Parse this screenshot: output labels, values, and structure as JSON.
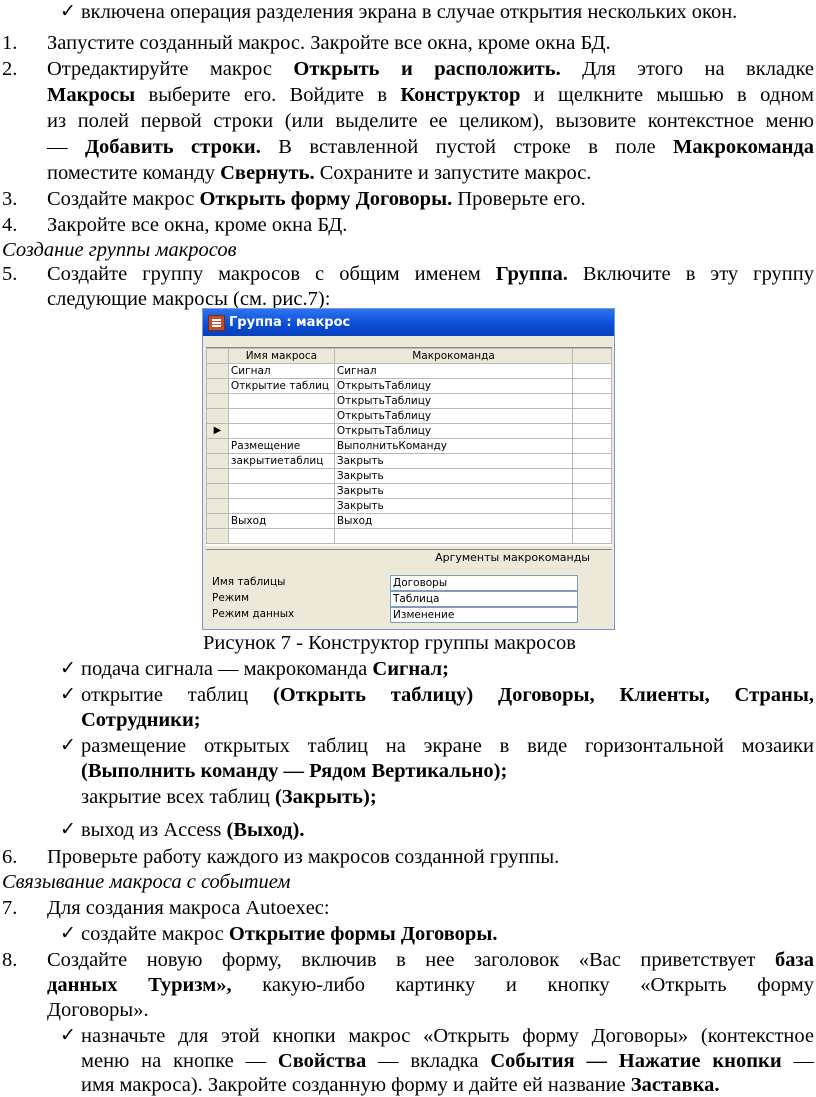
{
  "l1": "включена операция разделения экрана в случае открытия нескольких окон.",
  "s1": "Запустите созданный макрос. Закройте все окна, кроме окна БД.",
  "s2_a": "Отредактируйте макрос ",
  "s2_b": "Открыть и расположить.",
  "s2_c": " Для этого на вкладке",
  "s2_d": "Макросы",
  "s2_e": " выберите его. Войдите в ",
  "s2_f": "Конструктор",
  "s2_g": " и щелкните мышью в одном",
  "s2_h": "из полей первой строки (или выделите ее целиком), вызовите контекстное меню",
  "s2_i": "— ",
  "s2_j": "Добавить строки.",
  "s2_k": " В вставленной пустой строке в поле ",
  "s2_l": "Макрокоманда",
  "s2_m": "поместите команду ",
  "s2_n": "Свернуть.",
  "s2_o": " Сохраните и запустите макрос.",
  "s3_a": "Создайте макрос ",
  "s3_b": "Открыть форму Договоры.",
  "s3_c": " Проверьте его.",
  "s4": "Закройте все окна, кроме окна БД.",
  "h1": "Создание группы макросов",
  "s5_a": "Создайте группу макросов с общим именем ",
  "s5_b": "Группа.",
  "s5_c": " Включите в эту группу",
  "s5_d": "следующие макросы (см. рис.7):",
  "window": {
    "title": "Группа : макрос",
    "col1": "Имя макроса",
    "col2": "Макрокоманда",
    "rows": [
      [
        "Сигнал",
        "Сигнал"
      ],
      [
        "Открытие таблиц",
        "ОткрытьТаблицу"
      ],
      [
        "",
        "ОткрытьТаблицу"
      ],
      [
        "",
        "ОткрытьТаблицу"
      ],
      [
        "",
        "ОткрытьТаблицу"
      ],
      [
        "Размещение",
        "ВыполнитьКоманду"
      ],
      [
        "закрытиетаблиц",
        "Закрыть"
      ],
      [
        "",
        "Закрыть"
      ],
      [
        "",
        "Закрыть"
      ],
      [
        "",
        "Закрыть"
      ],
      [
        "Выход",
        "Выход"
      ],
      [
        "",
        ""
      ]
    ],
    "args_title": "Аргументы макрокоманды",
    "args": [
      [
        "Имя таблицы",
        "Договоры"
      ],
      [
        "Режим",
        "Таблица"
      ],
      [
        "Режим данных",
        "Изменение"
      ]
    ]
  },
  "caption": "Рисунок 7 - Конструктор группы макросов",
  "b1_a": "подача сигнала — макрокоманда ",
  "b1_b": "Сигнал;",
  "b2_a": "открытие таблиц ",
  "b2_b": "(Открыть таблицу) Договоры, Клиенты, Страны,",
  "b2_c": "Сотрудники;",
  "b3_a": "размещение открытых таблиц на экране в виде горизонтальной мозаики",
  "b3_b": "(Выполнить команду — Рядом Вертикально);",
  "b3_c_a": "закрытие всех таблиц ",
  "b3_c_b": "(Закрыть);",
  "b4_a": "выход из Access ",
  "b4_b": "(Выход).",
  "s6": "Проверьте работу каждого из макросов созданной группы.",
  "h2": "Связывание макроса с событием",
  "s7": "Для создания макроса Autoexec:",
  "b5_a": "создайте макрос ",
  "b5_b": "Открытие формы Договоры.",
  "s8_a": "Создайте новую форму, включив в нее заголовок «Вас приветствует ",
  "s8_b": "база",
  "s8_c": "данных Туризм»,",
  "s8_d": " какую-либо картинку и кнопку «Открыть форму",
  "s8_e": "Договоры».",
  "b6_a": "назначьте для этой кнопки макрос «Открыть форму Договоры» (контекстное",
  "b6_b": "меню на кнопке — ",
  "b6_c": "Свойства",
  "b6_d": " — вкладка ",
  "b6_e": "События — Нажатие кнопки",
  "b6_f": " —",
  "b6_g": "имя макроса). Закройте созданную форму и дайте ей название ",
  "b6_h": "Заставка.",
  "nums": [
    "1.",
    "2.",
    "3.",
    "4.",
    "5.",
    "6.",
    "7.",
    "8."
  ],
  "check": "✓"
}
